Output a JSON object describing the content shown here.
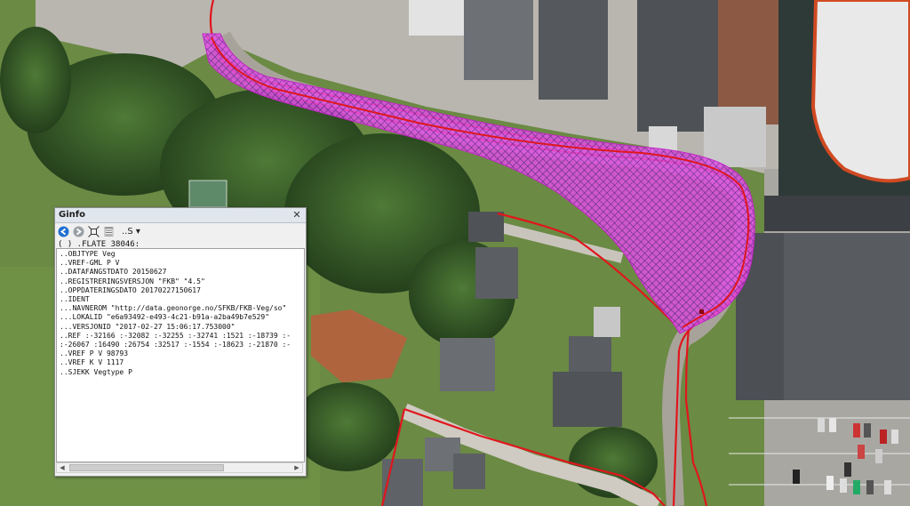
{
  "map": {
    "road_color": "#e0161c",
    "highlight_color": "#e040e0",
    "grass_color": "#6d8a46",
    "asphalt_color": "#b5b2ab",
    "roof_color": "#4a4c50"
  },
  "ginfo": {
    "title": "Ginfo",
    "close_symbol": "✕",
    "toolbar": {
      "back_icon": "back-arrow-icon",
      "forward_icon": "forward-arrow-icon",
      "zoom_icon": "zoom-extent-icon",
      "list_icon": "list-icon",
      "dropdown_label": "..S ▾"
    },
    "header": "( ) .FLATE 38046:",
    "lines": [
      "..OBJTYPE Veg",
      "..VREF-GML P V",
      "..DATAFANGSTDATO 20150627",
      "..REGISTRERINGSVERSJON \"FKB\" \"4.5\"",
      "..OPPDATERINGSDATO 20170227150617",
      "..IDENT",
      "...NAVNEROM \"http://data.geonorge.no/SFKB/FKB-Veg/so\"",
      "...LOKALID \"e6a93492-e493-4c21-b91a-a2ba49b7e529\"",
      "...VERSJONID \"2017-02-27 15:06:17.753000\"",
      "..REF :-32166 :-32082 :-32255 :-32741 :1521 :-18739 :-",
      ":-26067 :16490 :26754 :32517 :-1554 :-18623 :-21870 :-",
      "..VREF P V 98793",
      "..VREF K V 1117",
      "..SJEKK Vegtype P"
    ]
  }
}
